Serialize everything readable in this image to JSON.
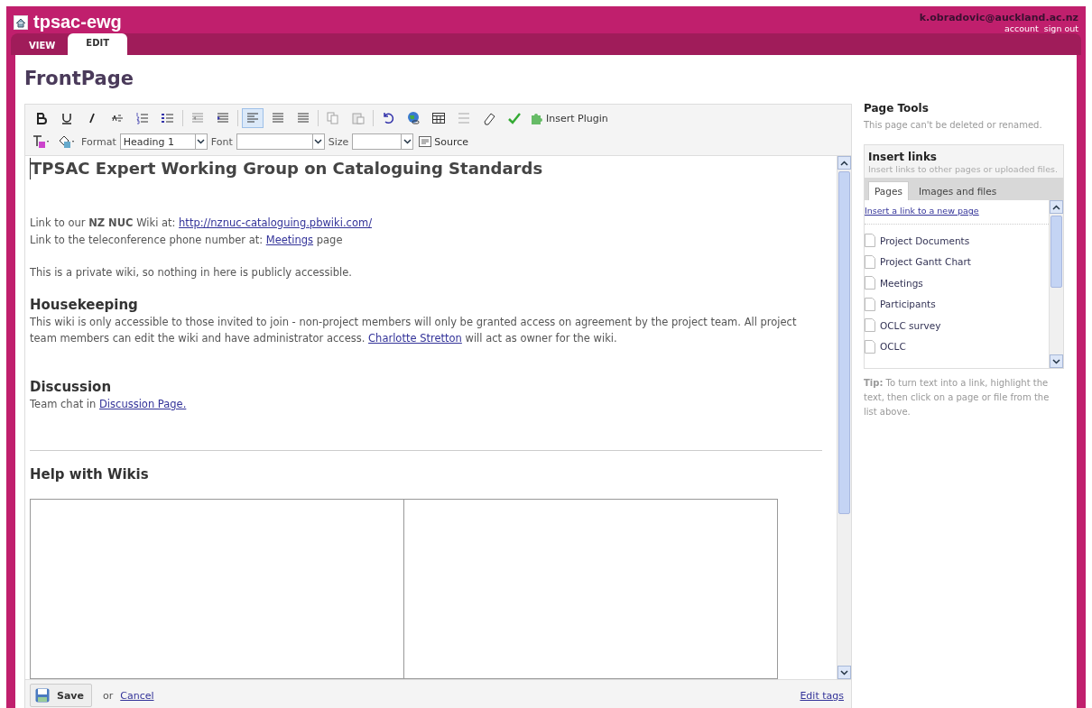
{
  "header": {
    "site_title": "tpsac-ewg",
    "user_email": "k.obradovic@auckland.ac.nz",
    "links": [
      "account",
      "sign out"
    ]
  },
  "tabs": [
    {
      "label": "VIEW",
      "selected": false
    },
    {
      "label": "EDIT",
      "selected": true
    }
  ],
  "page_title": "FrontPage",
  "toolbar": {
    "buttons": [
      {
        "selected": false
      },
      {
        "selected": false
      },
      {
        "selected": false
      },
      {
        "selected": false
      },
      {
        "selected": false
      },
      {
        "selected": false
      },
      {
        "selected": false
      },
      {
        "selected": false
      },
      {
        "selected": true
      },
      {
        "selected": false
      },
      {
        "selected": false
      },
      {
        "selected": false
      },
      {
        "selected": false
      },
      {
        "selected": false
      },
      {
        "selected": false
      },
      {
        "selected": false
      },
      {
        "selected": false
      },
      {
        "selected": false
      },
      {
        "selected": false
      }
    ],
    "plugin_label": "Insert Plugin",
    "format_label": "Format",
    "format_value": "Heading 1",
    "font_label": "Font",
    "size_label": "Size",
    "source_label": "Source"
  },
  "document": {
    "blocks": [
      {
        "kind": "h1",
        "text": "TPSAC Expert Working Group on Cataloguing Standards"
      },
      {
        "kind": "p",
        "segments": [
          {
            "kind": "text",
            "text": "Link to our **NZ NUC** Wiki at:   "
          },
          {
            "kind": "link",
            "text": "http://nznuc-cataloguing.pbwiki.com/"
          }
        ]
      },
      {
        "kind": "p",
        "segments": [
          {
            "kind": "text",
            "text": "Link to the teleconference phone number at: "
          },
          {
            "kind": "link",
            "text": "Meetings"
          },
          {
            "kind": "text",
            "text": " page"
          }
        ]
      },
      {
        "kind": "gap"
      },
      {
        "kind": "p",
        "segments": [
          {
            "kind": "text",
            "text": "This is a private wiki, so nothing in here is publicly accessible."
          }
        ]
      },
      {
        "kind": "h2",
        "text": "Housekeeping"
      },
      {
        "kind": "p",
        "segments": [
          {
            "kind": "text",
            "text": "This wiki is only accessible to those invited to join - non-project members will only be granted access on agreement by the project team.  All project team members can edit the wiki and have administrator access.  "
          },
          {
            "kind": "link",
            "text": "Charlotte Stretton"
          },
          {
            "kind": "text",
            "text": " will act as owner for the wiki."
          }
        ]
      },
      {
        "kind": "gap"
      },
      {
        "kind": "h2",
        "text": "Discussion"
      },
      {
        "kind": "p",
        "segments": [
          {
            "kind": "text",
            "text": "Team chat in "
          },
          {
            "kind": "link",
            "text": "Discussion Page."
          }
        ]
      },
      {
        "kind": "rule"
      },
      {
        "kind": "h2",
        "text": "Help with Wikis"
      },
      {
        "kind": "table"
      }
    ]
  },
  "footer": {
    "save_label": "Save",
    "or_text": "or",
    "cancel_label": "Cancel",
    "edit_tags_label": "Edit tags"
  },
  "sidebar": {
    "title": "Page Tools",
    "note": "This page can't be deleted or renamed.",
    "insert_links": {
      "title": "Insert links",
      "subtitle": "Insert links to other pages or uploaded files.",
      "tabs": [
        {
          "label": "Pages",
          "selected": true
        },
        {
          "label": "Images and files",
          "selected": false
        }
      ],
      "new_page_link": "Insert a link to a new page",
      "pages": [
        "Project Documents",
        "Project Gantt Chart",
        "Meetings",
        "Participants",
        "OCLC survey",
        "OCLC"
      ]
    },
    "tip_label": "Tip:",
    "tip_text": " To turn text into a link, highlight the text, then click on a page or file from the list above."
  }
}
